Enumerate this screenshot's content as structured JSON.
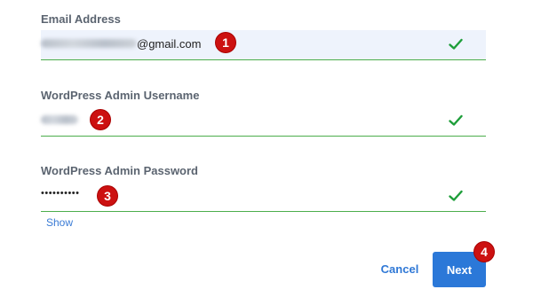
{
  "form": {
    "email": {
      "label": "Email Address",
      "value_suffix": "@gmail.com",
      "badge": "1",
      "status_icon": "check-icon"
    },
    "username": {
      "label": "WordPress Admin Username",
      "badge": "2",
      "status_icon": "check-icon"
    },
    "password": {
      "label": "WordPress Admin Password",
      "value": "••••••••••",
      "badge": "3",
      "status_icon": "check-icon"
    },
    "show_label": "Show"
  },
  "actions": {
    "cancel_label": "Cancel",
    "next_label": "Next",
    "next_badge": "4"
  },
  "colors": {
    "accent": "#2b78d8",
    "valid": "#1e9e3a",
    "badge": "#cc1111",
    "field_focus_bg": "#eef3fc"
  }
}
